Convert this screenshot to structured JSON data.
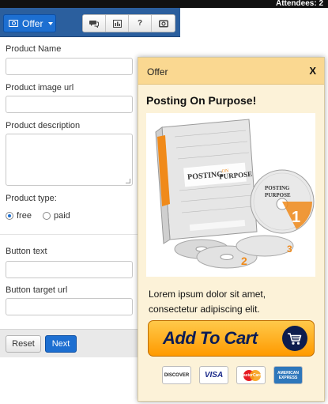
{
  "topbar": {
    "attendees": "Attendees: 2"
  },
  "toolbar": {
    "offer_label": "Offer",
    "buttons": [
      {
        "icon": "chat-icon"
      },
      {
        "icon": "chart-icon"
      },
      {
        "icon": "help-icon",
        "label": "?"
      },
      {
        "icon": "camera-icon"
      }
    ]
  },
  "form": {
    "product_name_label": "Product Name",
    "product_name_value": "",
    "product_image_label": "Product image url",
    "product_image_value": "",
    "product_description_label": "Product description",
    "product_description_value": "",
    "product_type_label": "Product type:",
    "product_type_options": [
      "free",
      "paid"
    ],
    "product_type_selected": "free",
    "button_text_label": "Button text",
    "button_text_value": "",
    "button_target_label": "Button target url",
    "button_target_value": "",
    "reset_label": "Reset",
    "next_label": "Next"
  },
  "offer_panel": {
    "title": "Offer",
    "close_label": "X",
    "headline": "Posting On Purpose!",
    "description": "Lorem ipsum dolor sit amet, consectetur adipiscing elit.",
    "cart_button_label": "Add To Cart",
    "payment_cards": [
      "DISCOVER",
      "VISA",
      "MasterCard",
      "AMERICAN EXPRESS"
    ]
  },
  "colors": {
    "toolbar_bg": "#2b5f9e",
    "primary_button": "#1d6fd1",
    "panel_header": "#fad891",
    "panel_bg": "#fcf2d8",
    "cart_button": "#ffb020"
  }
}
